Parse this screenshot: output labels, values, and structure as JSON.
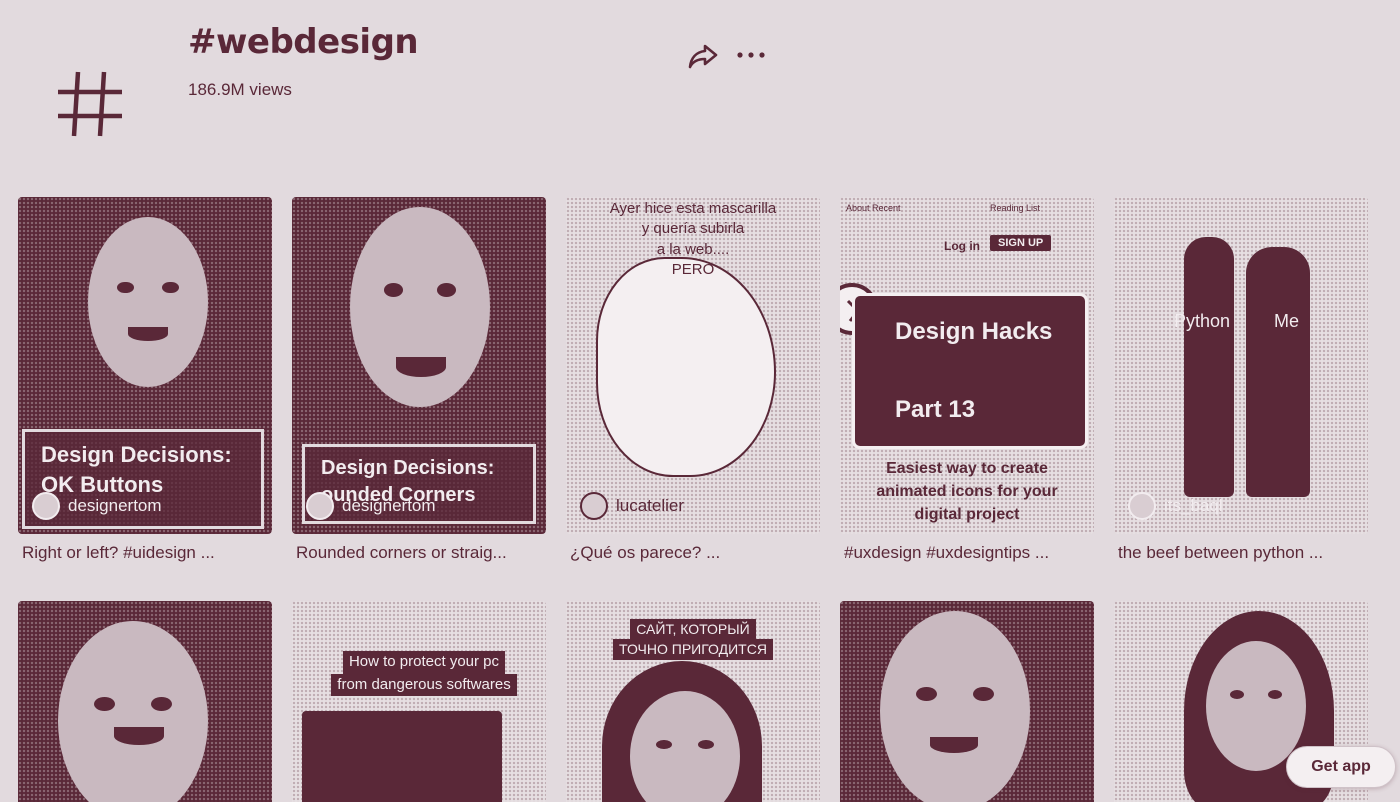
{
  "header": {
    "title": "#webdesign",
    "views": "186.9M views",
    "share_icon": "share-icon",
    "more_icon": "more-horizontal-icon"
  },
  "videos_row1": [
    {
      "overlay_line1": "Design Decisions:",
      "overlay_line2": "OK Buttons",
      "author": "designertom",
      "caption": "Right or left? #uidesign ..."
    },
    {
      "overlay_line1": "Design Decisions:",
      "overlay_line2": "ounded Corners",
      "author": "designertom",
      "caption": "Rounded corners or straig..."
    },
    {
      "text_lines": [
        "Ayer hice esta mascarilla",
        "y quería subirla",
        "a la web....",
        "PERO"
      ],
      "author": "lucatelier",
      "caption": "¿Qué os parece? ..."
    },
    {
      "nav_left": "About  Recent",
      "nav_right": "Reading List",
      "login": "Log in",
      "signup": "SIGN UP",
      "title_line1": "Design Hacks",
      "title_line2": "Part 13",
      "sub_line1": "Easiest way to create",
      "sub_line2": "animated icons for your",
      "sub_line3": "digital project",
      "caption": "#uxdesign #uxdesigntips ..."
    },
    {
      "label_left": "Python",
      "label_right": "Me",
      "author": "its_baql",
      "caption": "the beef between python ..."
    }
  ],
  "videos_row2": [
    {},
    {
      "text_line1": "How to protect your pc",
      "text_line2": "from dangerous softwares"
    },
    {
      "text_line1": "САЙТ, КОТОРЫЙ",
      "text_line2": "ТОЧНО ПРИГОДИТСЯ"
    },
    {},
    {}
  ],
  "get_app": "Get app",
  "colors": {
    "background": "#e2dade",
    "accent": "#5a2838"
  }
}
